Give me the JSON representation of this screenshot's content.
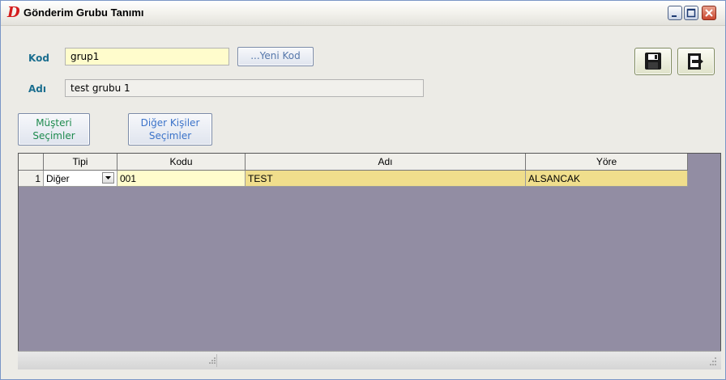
{
  "window": {
    "title": "Gönderim Grubu Tanımı",
    "app_icon_letter": "D"
  },
  "form": {
    "kod_label": "Kod",
    "kod_value": "grup1",
    "adi_label": "Adı",
    "adi_value": "test grubu 1",
    "yeni_kod_label": "...Yeni Kod"
  },
  "buttons": {
    "musteri_line1": "Müşteri",
    "musteri_line2": "Seçimler",
    "diger_line1": "Diğer Kişiler",
    "diger_line2": "Seçimler"
  },
  "grid": {
    "columns": [
      "Tipi",
      "Kodu",
      "Adı",
      "Yöre"
    ],
    "rows": [
      {
        "num": "1",
        "tipi": "Diğer",
        "kodu": "001",
        "adi": "TEST",
        "yore": "ALSANCAK"
      }
    ]
  },
  "colors": {
    "label_blue": "#1b6e8f",
    "input_yellow": "#fffccc",
    "cell_yellow": "#f0de8c",
    "grid_bg": "#928da3"
  }
}
